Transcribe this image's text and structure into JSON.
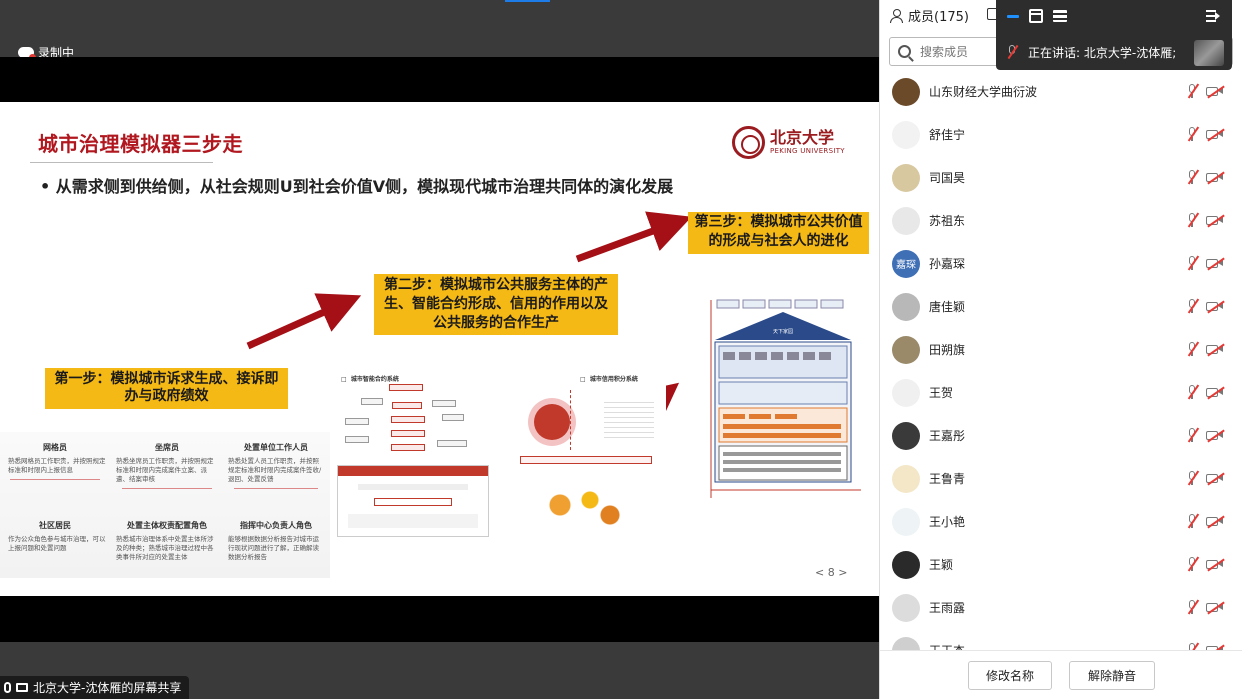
{
  "share": {
    "recording_label": "录制中",
    "share_status": "北京大学-沈体雁的屏幕共享"
  },
  "slide": {
    "title": "城市治理模拟器三步走",
    "bullet": "•  从需求侧到供给侧，从社会规则U到社会价值V侧，模拟现代城市治理共同体的演化发展",
    "logo_cn": "北京大学",
    "logo_en": "PEKING UNIVERSITY",
    "step1": "第一步：模拟城市诉求生成、接诉即办与政府绩效",
    "step2": "第二步：模拟城市公共服务主体的产生、智能合约形成、信用的作用以及公共服务的合作生产",
    "step3": "第三步：模拟城市公共价值的形成与社会人的进化",
    "page_number": "< 8 >",
    "mini_titles": [
      "城市智能合约系统",
      "城市信用积分系统"
    ],
    "roles": [
      {
        "name": "网格员",
        "desc": "熟悉网格员工作职责，并按照规定标准和时限内上报信息"
      },
      {
        "name": "坐席员",
        "desc": "熟悉坐席员工作职责，并按照规定标准和时限内完成案件立案、派遣、结案审核"
      },
      {
        "name": "处置单位工作人员",
        "desc": "熟悉处置人员工作职责，并按照规定标准和时限内完成案件签收/退回、处置反馈"
      },
      {
        "name": "社区居民",
        "desc": "作为公众角色参与城市治理，可以上报问题和处置问题"
      },
      {
        "name": "处置主体权责配置角色",
        "desc": "熟悉城市治理体系中处置主体所涉及的种类；熟悉城市治理过程中各类事件所对应的处置主体"
      },
      {
        "name": "指挥中心负责人角色",
        "desc": "能够根据数据分析报告对城市运行现状问题进行了解，正确解读数据分析报告"
      }
    ],
    "pyramid_top": "天下家园"
  },
  "panel": {
    "title": "成员(175)",
    "search_placeholder": "搜索成员",
    "members": [
      {
        "name": "山东财经大学曲衍波",
        "avatar_text": "",
        "avatar_color": "#6b4a2a"
      },
      {
        "name": "舒佳宁",
        "avatar_text": "",
        "avatar_color": "#f2f2f2"
      },
      {
        "name": "司国昊",
        "avatar_text": "",
        "avatar_color": "#d8c8a0"
      },
      {
        "name": "苏祖东",
        "avatar_text": "",
        "avatar_color": "#e8e8e8"
      },
      {
        "name": "孙嘉琛",
        "avatar_text": "嘉琛",
        "avatar_color": "#3f6fb5"
      },
      {
        "name": "唐佳颖",
        "avatar_text": "",
        "avatar_color": "#b8b8b8"
      },
      {
        "name": "田朔旗",
        "avatar_text": "",
        "avatar_color": "#9a8a6a"
      },
      {
        "name": "王贺",
        "avatar_text": "",
        "avatar_color": "#f0f0f0"
      },
      {
        "name": "王嘉彤",
        "avatar_text": "",
        "avatar_color": "#3a3a3a"
      },
      {
        "name": "王鲁青",
        "avatar_text": "",
        "avatar_color": "#f3e7c8"
      },
      {
        "name": "王小艳",
        "avatar_text": "",
        "avatar_color": "#eef3f6"
      },
      {
        "name": "王颖",
        "avatar_text": "",
        "avatar_color": "#2a2a2a"
      },
      {
        "name": "王雨露",
        "avatar_text": "",
        "avatar_color": "#dcdcdc"
      },
      {
        "name": "王玉杰",
        "avatar_text": "",
        "avatar_color": "#cfcfcf"
      }
    ],
    "rename_label": "修改名称",
    "unmute_label": "解除静音"
  },
  "floater": {
    "speaking_label": "正在讲话:  北京大学-沈体雁;"
  },
  "colors": {
    "accent_red": "#b0171f",
    "step_yellow": "#f5b915",
    "toolbar_blue": "#1e90ff"
  }
}
